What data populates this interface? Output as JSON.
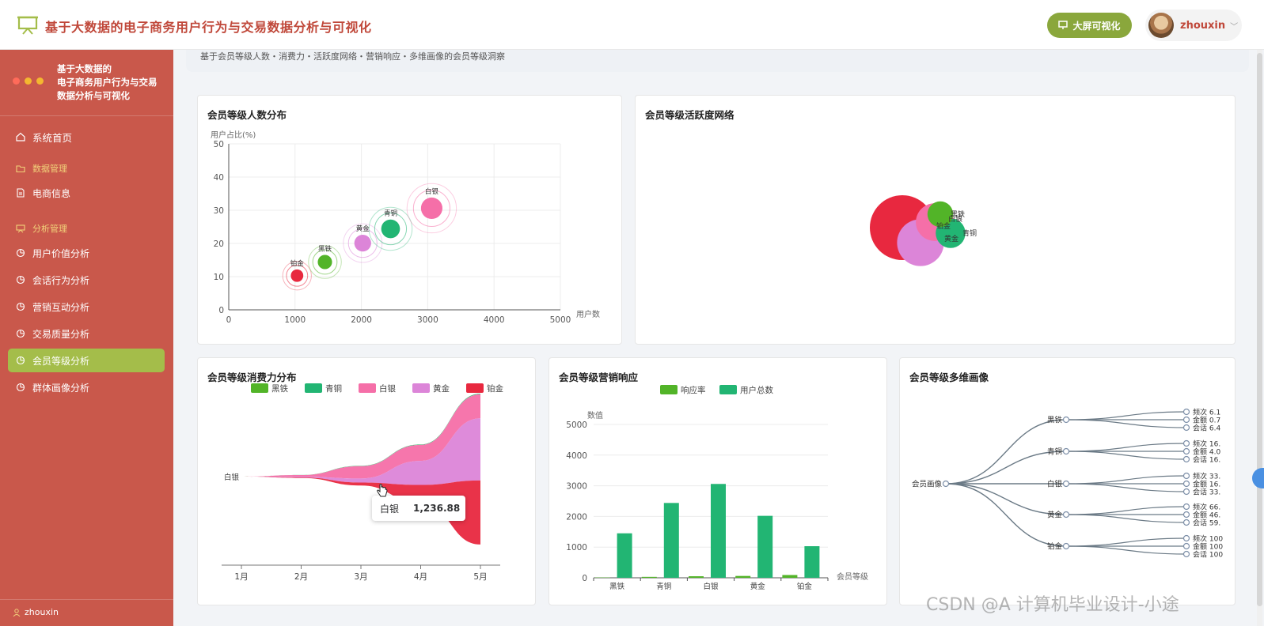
{
  "app": {
    "title": "基于大数据的电子商务用户行为与交易数据分析与可视化",
    "big_screen_button": "大屏可视化",
    "user": "zhouxin"
  },
  "sidebar": {
    "title_line1": "基于大数据的",
    "title_line2": "电子商务用户行为与交易",
    "title_line3": "数据分析与可视化",
    "items": [
      {
        "label": "系统首页",
        "icon": "home-icon"
      },
      {
        "label": "数据管理",
        "icon": "folder-icon",
        "group": true
      },
      {
        "label": "电商信息",
        "icon": "document-icon"
      },
      {
        "label": "分析管理",
        "icon": "chart-board-icon",
        "group": true
      },
      {
        "label": "用户价值分析",
        "icon": "pie-icon"
      },
      {
        "label": "会话行为分析",
        "icon": "pie-icon"
      },
      {
        "label": "营销互动分析",
        "icon": "pie-icon"
      },
      {
        "label": "交易质量分析",
        "icon": "pie-icon"
      },
      {
        "label": "会员等级分析",
        "icon": "pie-icon",
        "active": true
      },
      {
        "label": "群体画像分析",
        "icon": "pie-icon"
      }
    ],
    "footer_user": "zhouxin"
  },
  "page": {
    "subtitle": "基于会员等级人数・消费力・活跃度网络・营销响应・多维画像的会员等级洞察"
  },
  "colors": {
    "sidebar_bg": "#c9584b",
    "active_item": "#a4bd4a",
    "heitie": "#52b428",
    "qingtong": "#22b573",
    "baiyin": "#f56fa8",
    "huangjin": "#dc85d8",
    "bojin": "#e8283f"
  },
  "watermark": "CSDN @A 计算机毕业设计-小途",
  "charts": {
    "scatter": {
      "title": "会员等级人数分布",
      "ylabel": "用户占比(%)",
      "xlabel": "用户数"
    },
    "network": {
      "title": "会员等级活跃度网络"
    },
    "stream": {
      "title": "会员等级消费力分布",
      "tooltip_label": "白银",
      "tooltip_value": "1,236.88"
    },
    "bar": {
      "title": "会员等级营销响应",
      "ylabel": "数值",
      "xlabel": "会员等级"
    },
    "tree": {
      "title": "会员等级多维画像",
      "root": "会员画像"
    }
  },
  "chart_data": [
    {
      "type": "scatter",
      "title": "会员等级人数分布",
      "xlabel": "用户数",
      "ylabel": "用户占比(%)",
      "xlim": [
        0,
        5000
      ],
      "ylim": [
        0,
        50
      ],
      "x_ticks": [
        "0",
        "1000",
        "2000",
        "3000",
        "4000",
        "5000"
      ],
      "y_ticks": [
        "0",
        "10",
        "20",
        "30",
        "40",
        "50"
      ],
      "grid": true,
      "points": [
        {
          "name": "铂金",
          "x": 1030,
          "y": 10.3,
          "color": "#e8283f"
        },
        {
          "name": "黑铁",
          "x": 1450,
          "y": 14.4,
          "color": "#52b428"
        },
        {
          "name": "黄金",
          "x": 2020,
          "y": 20.1,
          "color": "#dc85d8"
        },
        {
          "name": "青铜",
          "x": 2440,
          "y": 24.4,
          "color": "#22b573"
        },
        {
          "name": "白银",
          "x": 3060,
          "y": 30.6,
          "color": "#f56fa8"
        }
      ]
    },
    {
      "type": "area",
      "subtype": "themeRiver",
      "title": "会员等级消费力分布",
      "legend": [
        "黑铁",
        "青铜",
        "白银",
        "黄金",
        "铂金"
      ],
      "legend_placement": "top",
      "categories": [
        "1月",
        "2月",
        "3月",
        "4月",
        "5月"
      ],
      "axis_label": "白银",
      "series": [
        {
          "name": "黑铁",
          "values": [
            0,
            2,
            5,
            8,
            10
          ]
        },
        {
          "name": "青铜",
          "values": [
            0,
            10,
            30,
            40,
            60
          ]
        },
        {
          "name": "白银",
          "values": [
            0,
            150,
            1236.88,
            1600,
            2400
          ]
        },
        {
          "name": "黄金",
          "values": [
            0,
            80,
            400,
            2400,
            6200
          ]
        },
        {
          "name": "铂金",
          "values": [
            0,
            60,
            300,
            1800,
            6400
          ]
        }
      ]
    },
    {
      "type": "bar",
      "title": "会员等级营销响应",
      "legend": [
        "响应率",
        "用户总数"
      ],
      "legend_placement": "top",
      "categories": [
        "黑铁",
        "青铜",
        "白银",
        "黄金",
        "铂金"
      ],
      "xlabel": "会员等级",
      "ylabel": "数值",
      "ylim": [
        0,
        5000
      ],
      "y_ticks": [
        "0",
        "1000",
        "2000",
        "3000",
        "4000",
        "5000"
      ],
      "series": [
        {
          "name": "响应率",
          "color": "#52b428",
          "values": [
            10,
            30,
            50,
            60,
            90
          ]
        },
        {
          "name": "用户总数",
          "color": "#22b573",
          "values": [
            1450,
            2440,
            3060,
            2020,
            1030
          ]
        }
      ]
    },
    {
      "type": "tree",
      "title": "会员等级多维画像",
      "root": "会员画像",
      "children": [
        {
          "name": "黑铁",
          "leaves": [
            "频次 6.1",
            "金额 0.7",
            "会话 6.4"
          ]
        },
        {
          "name": "青铜",
          "leaves": [
            "频次 16.",
            "金额 4.0",
            "会话 16."
          ]
        },
        {
          "name": "白银",
          "leaves": [
            "频次 33.",
            "金额 16.",
            "会话 33."
          ]
        },
        {
          "name": "黄金",
          "leaves": [
            "频次 66.",
            "金额 46.",
            "会话 59."
          ]
        },
        {
          "name": "铂金",
          "leaves": [
            "频次 100",
            "金额 100",
            "会话 100"
          ]
        }
      ]
    },
    {
      "type": "network",
      "title": "会员等级活跃度网络",
      "nodes": [
        {
          "name": "铂金",
          "value": 100,
          "color": "#e8283f"
        },
        {
          "name": "黄金",
          "value": 40,
          "color": "#dc85d8"
        },
        {
          "name": "白银",
          "value": 20,
          "color": "#f56fa8"
        },
        {
          "name": "青铜",
          "value": 8,
          "color": "#22b573"
        },
        {
          "name": "黑铁",
          "value": 4,
          "color": "#52b428"
        }
      ]
    }
  ]
}
